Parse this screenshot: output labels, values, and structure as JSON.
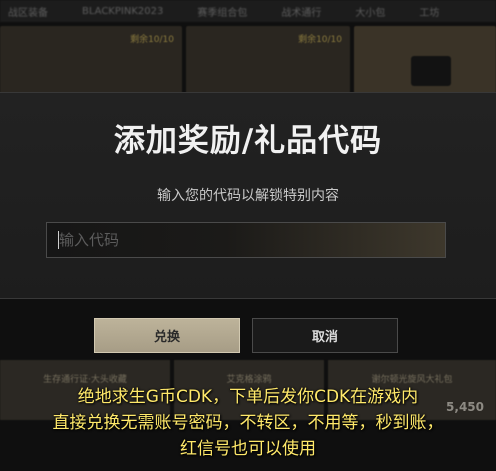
{
  "background": {
    "tabs": [
      "战区装备",
      "BLACKPINK2023",
      "赛季组合包",
      "战术通行",
      "大小包",
      "工坊"
    ],
    "top_cards": [
      {
        "caption": "剩余10/10"
      },
      {
        "caption": "剩余10/10"
      }
    ],
    "bottom_cards": [
      {
        "caption": "生存通行证·大头收藏"
      },
      {
        "caption": "艾克格涂鸦"
      },
      {
        "caption": "谢尔顿光旋风大礼包"
      }
    ],
    "price": "5,450"
  },
  "modal": {
    "title": "添加奖励/礼品代码",
    "subtitle": "输入您的代码以解锁特别内容",
    "input": {
      "placeholder": "输入代码",
      "value": ""
    },
    "confirm_label": "兑换",
    "cancel_label": "取消"
  },
  "promo_caption": {
    "line1": "绝地求生G币CDK，下单后发你CDK在游戏内",
    "line2": "直接兑换无需账号密码，不转区，不用等，秒到账，",
    "line3": "红信号也可以使用"
  },
  "colors": {
    "accent_button": "#b4aa92",
    "promo_text": "#ffe96a",
    "modal_bg": "#202020"
  }
}
